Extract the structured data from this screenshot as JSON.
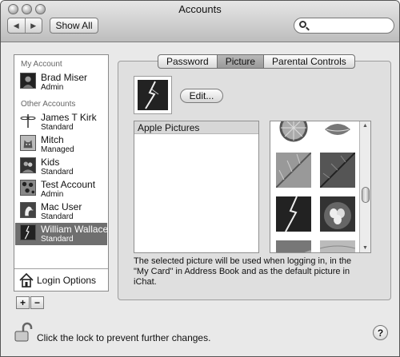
{
  "window": {
    "title": "Accounts"
  },
  "toolbar": {
    "show_all": "Show All",
    "search": {
      "value": "",
      "placeholder": ""
    }
  },
  "sidebar": {
    "my_account_header": "My Account",
    "other_accounts_header": "Other Accounts",
    "my_account": {
      "name": "Brad Miser",
      "type": "Admin"
    },
    "accounts": [
      {
        "name": "James T Kirk",
        "type": "Standard"
      },
      {
        "name": "Mitch",
        "type": "Managed"
      },
      {
        "name": "Kids",
        "type": "Standard"
      },
      {
        "name": "Test Account",
        "type": "Admin"
      },
      {
        "name": "Mac User",
        "type": "Standard"
      },
      {
        "name": "William Wallace",
        "type": "Standard"
      }
    ],
    "login_options": "Login Options",
    "add_label": "+",
    "remove_label": "−"
  },
  "tabs": [
    "Password",
    "Picture",
    "Parental Controls"
  ],
  "picture_panel": {
    "edit_label": "Edit...",
    "list_header": "Apple Pictures",
    "caption": "The selected picture will be used when logging in, in the \"My Card\" in Address Book and as the default picture in iChat."
  },
  "footer": {
    "lock_text": "Click the lock to prevent further changes.",
    "help_label": "?"
  },
  "colors": {
    "selection": "#6f6f6f",
    "active_tab": "#a6a6a6"
  }
}
